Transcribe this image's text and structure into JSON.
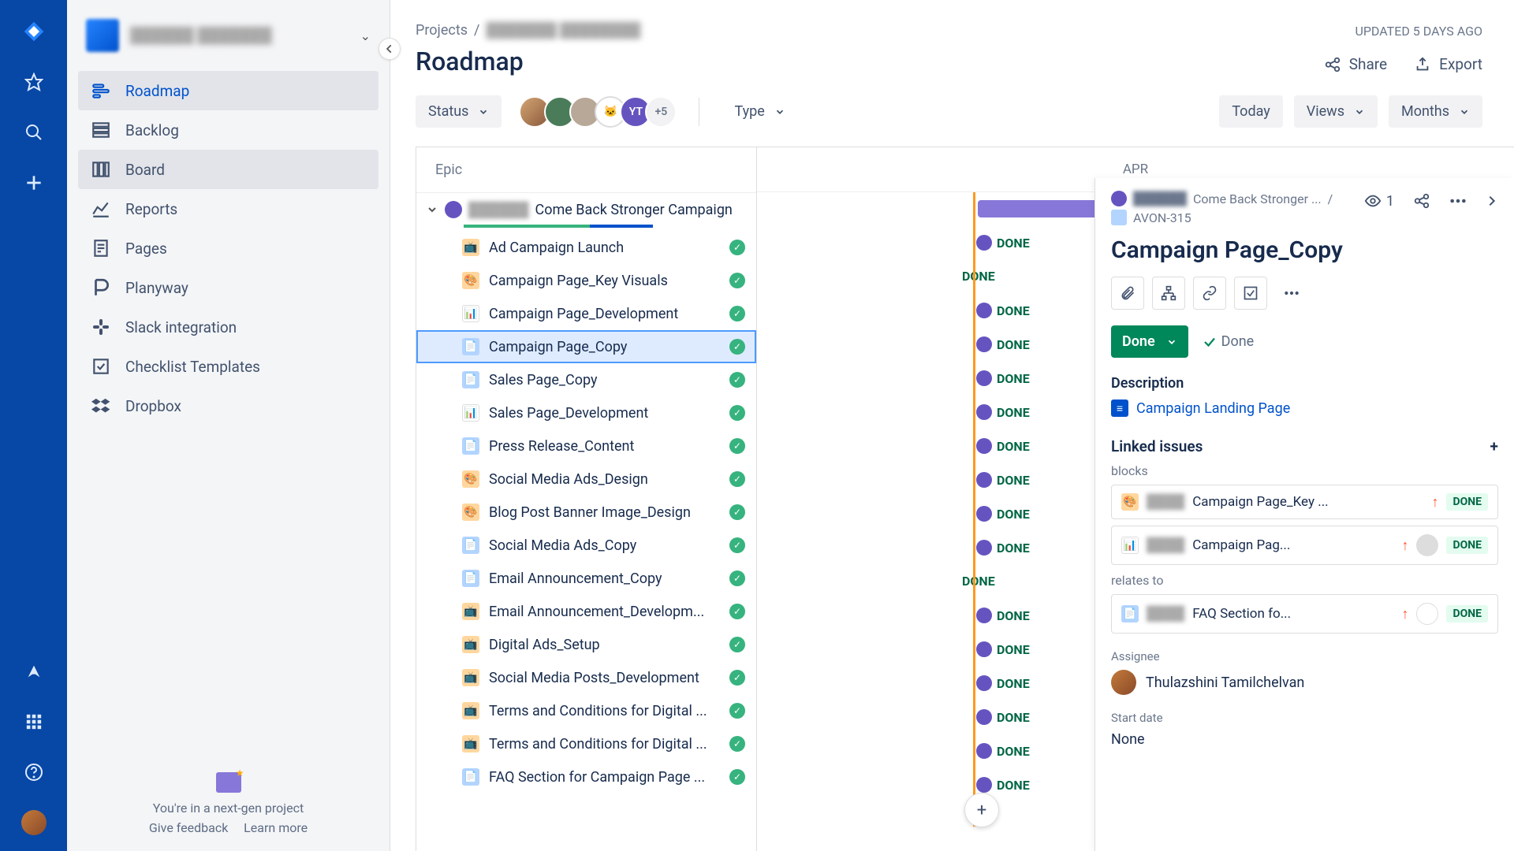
{
  "breadcrumb": {
    "projects": "Projects",
    "sep": "/"
  },
  "updated": "UPDATED 5 DAYS AGO",
  "page_title": "Roadmap",
  "header_actions": {
    "share": "Share",
    "export": "Export"
  },
  "toolbar": {
    "status": "Status",
    "type": "Type",
    "avatars_more": "+5",
    "today": "Today",
    "views": "Views",
    "months": "Months"
  },
  "nav": {
    "roadmap": "Roadmap",
    "backlog": "Backlog",
    "board": "Board",
    "reports": "Reports",
    "pages": "Pages",
    "planyway": "Planyway",
    "slack": "Slack integration",
    "checklist": "Checklist Templates",
    "dropbox": "Dropbox"
  },
  "sidebar_footer": {
    "line": "You're in a next-gen project",
    "feedback": "Give feedback",
    "learn": "Learn more"
  },
  "epic_header": "Epic",
  "month": "APR",
  "epic_group": "Come Back Stronger Campaign",
  "done": "DONE",
  "rows": [
    {
      "name": "Ad Campaign Launch"
    },
    {
      "name": "Campaign Page_Key Visuals"
    },
    {
      "name": "Campaign Page_Development"
    },
    {
      "name": "Campaign Page_Copy"
    },
    {
      "name": "Sales Page_Copy"
    },
    {
      "name": "Sales Page_Development"
    },
    {
      "name": "Press Release_Content"
    },
    {
      "name": "Social Media Ads_Design"
    },
    {
      "name": "Blog Post Banner Image_Design"
    },
    {
      "name": "Social Media Ads_Copy"
    },
    {
      "name": "Email Announcement_Copy"
    },
    {
      "name": "Email Announcement_Developm..."
    },
    {
      "name": "Digital Ads_Setup"
    },
    {
      "name": "Social Media Posts_Development"
    },
    {
      "name": "Terms and Conditions for Digital ..."
    },
    {
      "name": "Terms and Conditions for Digital ..."
    },
    {
      "name": "FAQ Section for Campaign Page ..."
    }
  ],
  "panel": {
    "bc_project": "Come Back Stronger ...",
    "bc_sep": "/",
    "bc_key": "AVON-315",
    "watch_count": "1",
    "title": "Campaign Page_Copy",
    "status_btn": "Done",
    "status_label": "Done",
    "desc_h": "Description",
    "doc": "Campaign Landing Page",
    "linked_h": "Linked issues",
    "blocks": "blocks",
    "relates": "relates to",
    "links": [
      {
        "name": "Campaign Page_Key ..."
      },
      {
        "name": "Campaign Pag..."
      }
    ],
    "relates_links": [
      {
        "name": "FAQ Section fo..."
      }
    ],
    "done_badge": "DONE",
    "assignee_label": "Assignee",
    "assignee": "Thulazshini Tamilchelvan",
    "start_label": "Start date",
    "start": "None"
  }
}
